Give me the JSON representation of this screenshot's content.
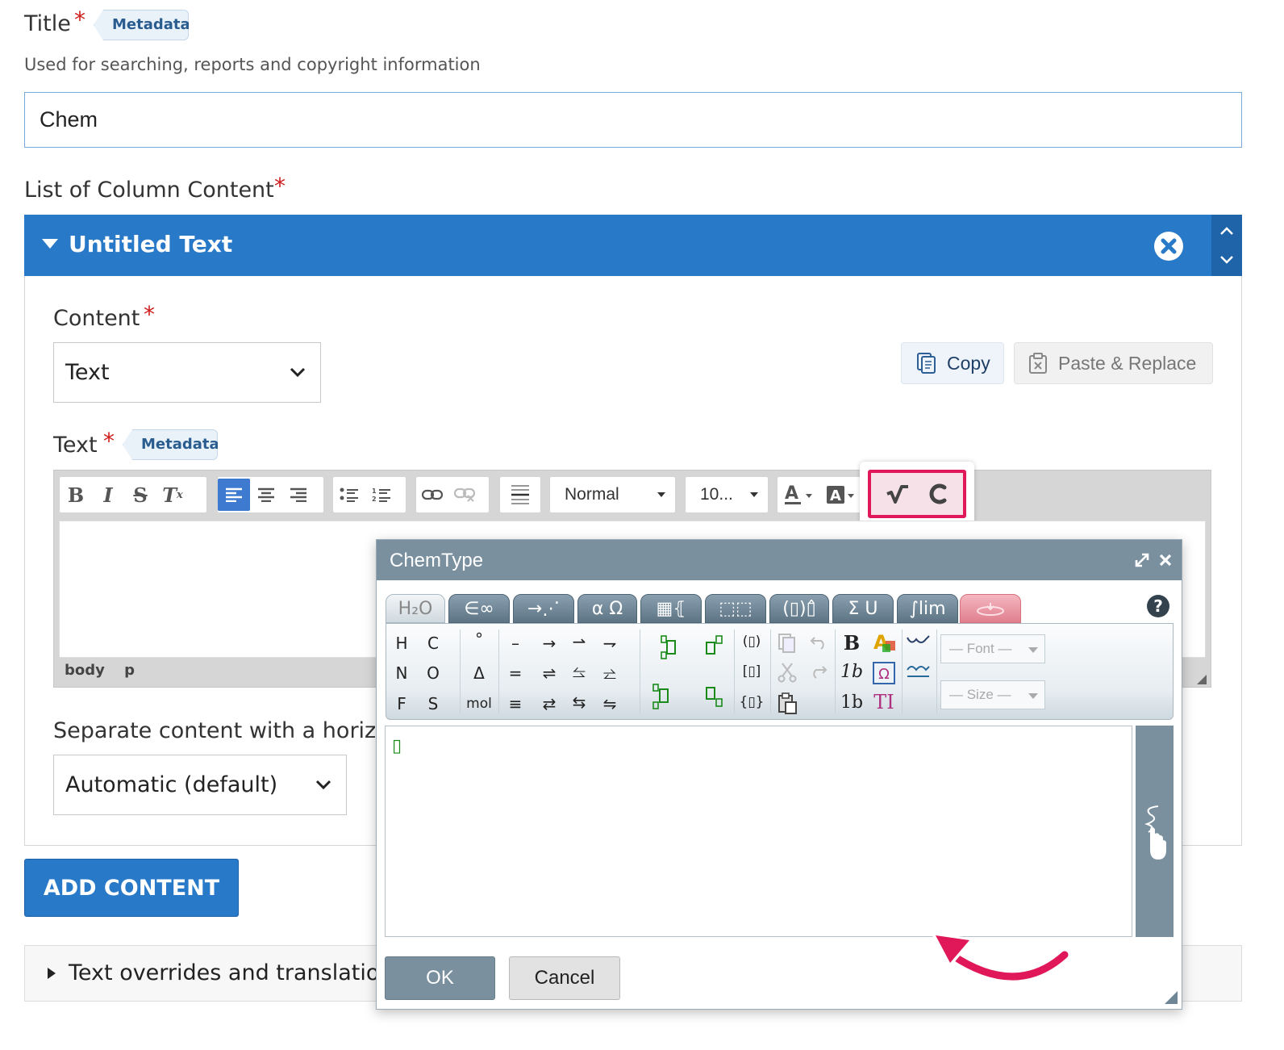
{
  "title_field": {
    "label": "Title",
    "required_mark": "*",
    "metadata_tag": "Metadata",
    "help_text": "Used for searching, reports and copyright information",
    "value": "Chem"
  },
  "column_content": {
    "label": "List of Column Content",
    "required_mark": "*",
    "item_title": "Untitled Text",
    "content": {
      "label": "Content",
      "required_mark": "*",
      "selected": "Text"
    },
    "copy_label": "Copy",
    "paste_label": "Paste & Replace",
    "text": {
      "label": "Text",
      "required_mark": "*",
      "metadata_tag": "Metadata"
    },
    "editor": {
      "format_select": "Normal",
      "size_select": "10...",
      "path": [
        "body",
        "p"
      ]
    },
    "separator": {
      "label": "Separate content with a horiz",
      "selected": "Automatic (default)"
    }
  },
  "add_content_label": "ADD CONTENT",
  "overrides_label": "Text overrides and translation",
  "chemtype": {
    "title": "ChemType",
    "tabs": [
      "H₂O",
      "∈∞",
      "→⋰",
      "α Ω",
      "▦⦃",
      "⬚⬚",
      "(▯)▯̂",
      "Σ U",
      "∫lim",
      ""
    ],
    "help": "?",
    "elements": [
      "H",
      "C",
      "N",
      "O",
      "F",
      "S"
    ],
    "symbols": [
      "°",
      "Δ",
      "mol"
    ],
    "bonds": [
      "–",
      "=",
      "≡"
    ],
    "arrows": [
      "→",
      "⇀",
      "⇁",
      "⇌",
      "⥦",
      "⥨",
      "⇄",
      "⇆",
      "⇋"
    ],
    "brackets": [
      "(▯)",
      "[▯]",
      "{▯}"
    ],
    "styles": [
      "B",
      "1b",
      "1b",
      "TI"
    ],
    "font_select": "— Font —",
    "size_select": "— Size —",
    "cursor_glyph": "▯",
    "ok_label": "OK",
    "cancel_label": "Cancel"
  },
  "colors": {
    "accent_blue": "#2879c8",
    "highlight_pink": "#e0185a",
    "dialog_header": "#7a909f"
  }
}
